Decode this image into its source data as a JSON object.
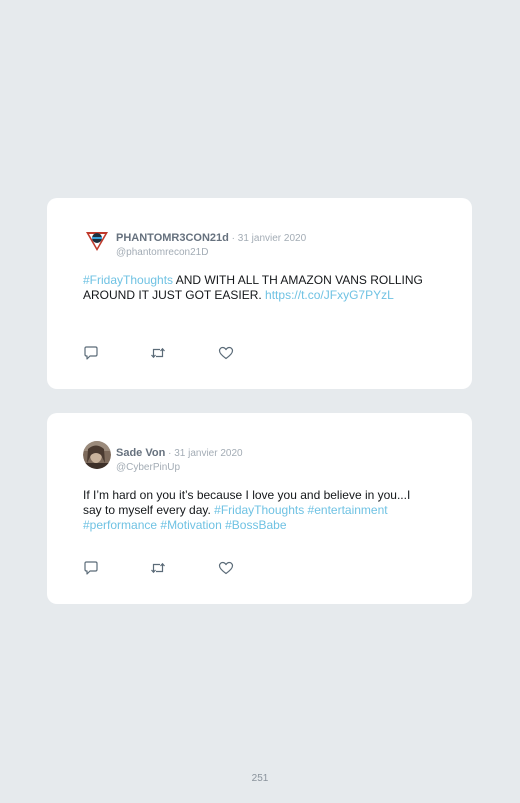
{
  "tweets": [
    {
      "display_name": "PHANTOMR3CON21d",
      "separator_date": " · 31 janvier 2020",
      "handle": "@phantomrecon21D",
      "text_segments": [
        {
          "text": "#FridayThoughts",
          "link": true
        },
        {
          "text": " AND WITH ALL TH AMAZON VANS ROLLING AROUND IT JUST GOT EASIER. ",
          "link": false
        },
        {
          "text": "https://t.co/JFxyG7PYzL",
          "link": true
        }
      ],
      "avatar_icon": "shield-logo-icon"
    },
    {
      "display_name": "Sade Von",
      "separator_date": " · 31 janvier 2020",
      "handle": "@CyberPinUp",
      "text_segments": [
        {
          "text": "If I’m hard on you it’s because I love you and believe in you...I say to myself every day. ",
          "link": false
        },
        {
          "text": "#FridayThoughts",
          "link": true
        },
        {
          "text": " ",
          "link": false
        },
        {
          "text": "#entertainment",
          "link": true
        },
        {
          "text": " ",
          "link": false
        },
        {
          "text": "#performance",
          "link": true
        },
        {
          "text": " ",
          "link": false
        },
        {
          "text": "#Motivation",
          "link": true
        },
        {
          "text": " ",
          "link": false
        },
        {
          "text": "#BossBabe",
          "link": true
        }
      ],
      "avatar_icon": "profile-photo"
    }
  ],
  "actions": [
    "reply-icon",
    "retweet-icon",
    "like-icon"
  ],
  "colors": {
    "background": "#e6eaed",
    "card": "#ffffff",
    "link": "#6fc2e3",
    "name": "#66717e",
    "meta": "#a3acb5"
  },
  "page_number": "251"
}
